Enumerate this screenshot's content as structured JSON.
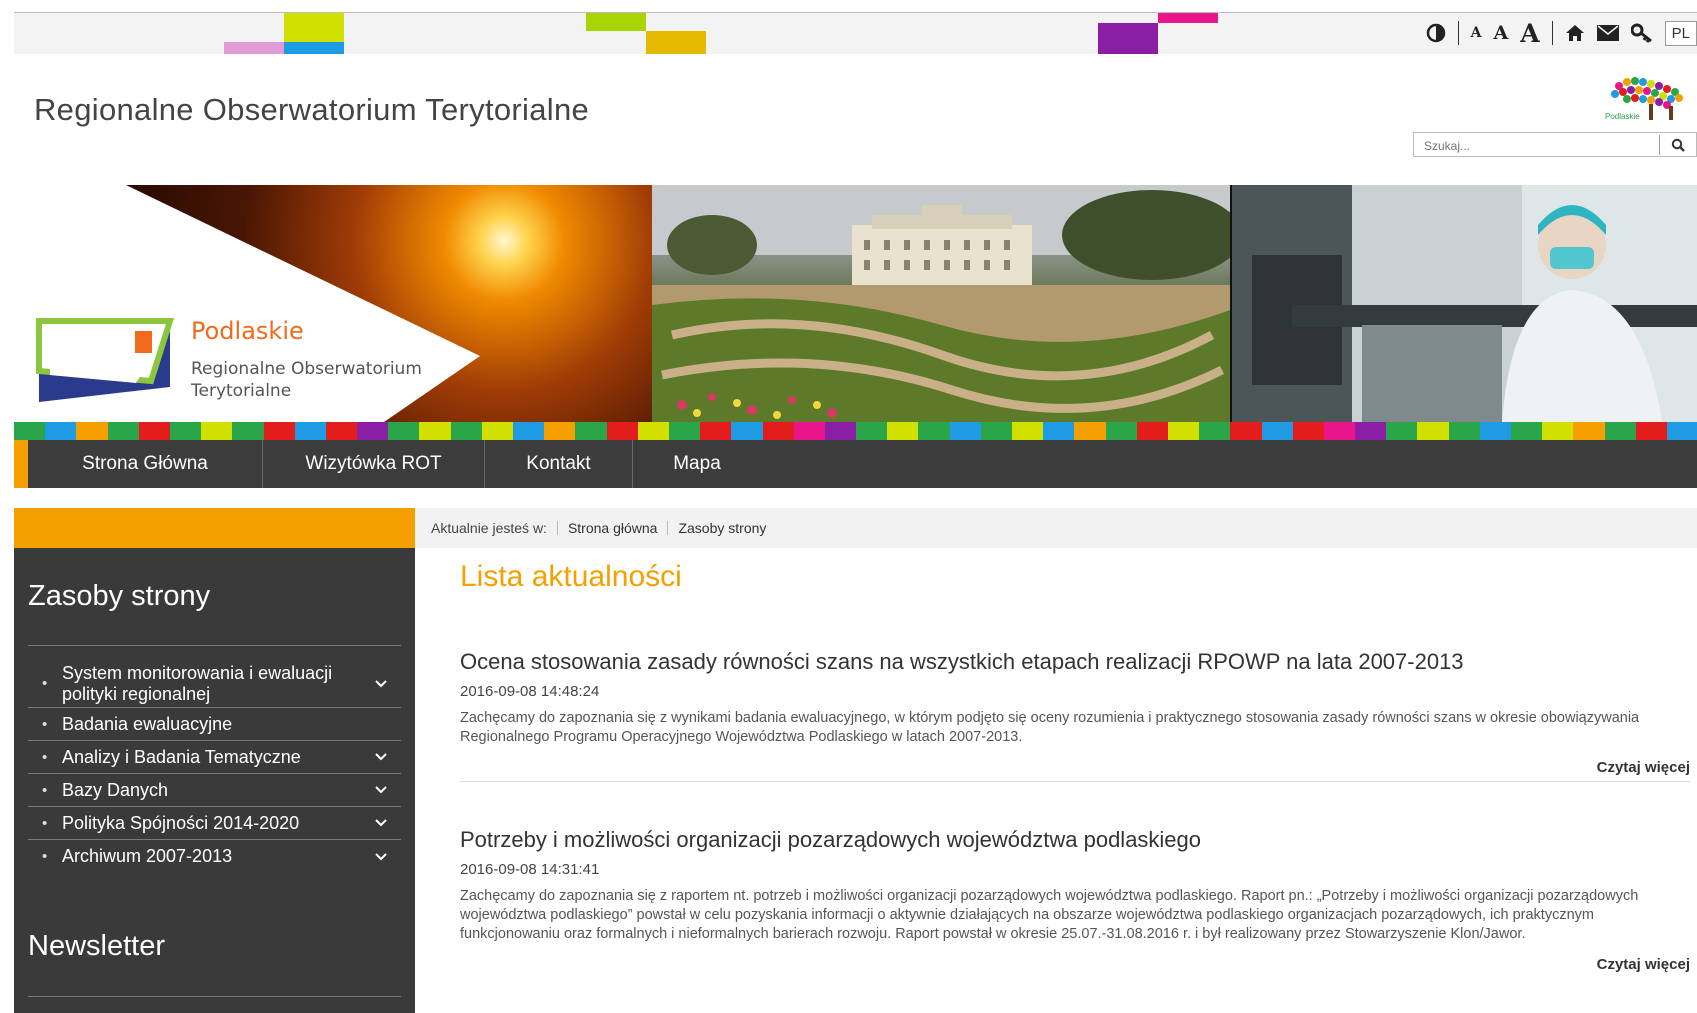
{
  "colors": {
    "accent": "#f5a000",
    "nav_bg": "#3c3c3c",
    "sidebar_bg": "#3a3a3a",
    "title_accent": "#f5a000"
  },
  "toolbar": {
    "icons": [
      "contrast-icon",
      "font-small-icon",
      "font-medium-icon",
      "font-large-icon",
      "home-icon",
      "mail-icon",
      "key-icon"
    ],
    "font_small": "A",
    "font_medium": "A",
    "font_large": "A",
    "language": "PL"
  },
  "header": {
    "site_title": "Regionalne Obserwatorium Terytorialne",
    "brand_logo_text": "Podlaskie"
  },
  "search": {
    "placeholder": "Szukaj...",
    "icon": "search-icon"
  },
  "banner": {
    "logo_name": "Podlaskie",
    "logo_subtitle_line1": "Regionalne Obserwatorium",
    "logo_subtitle_line2": "Terytorialne"
  },
  "nav": {
    "items": [
      {
        "label": "Strona Główna"
      },
      {
        "label": "Wizytówka ROT"
      },
      {
        "label": "Kontakt"
      },
      {
        "label": "Mapa"
      }
    ]
  },
  "breadcrumb": {
    "prefix": "Aktualnie jesteś w:",
    "items": [
      "Strona główna",
      "Zasoby strony"
    ]
  },
  "sidebar": {
    "title": "Zasoby strony",
    "menu": [
      {
        "label": "System monitorowania i ewaluacji polityki regionalnej",
        "has_submenu": true
      },
      {
        "label": "Badania ewaluacyjne",
        "has_submenu": false
      },
      {
        "label": "Analizy i Badania Tematyczne",
        "has_submenu": true
      },
      {
        "label": "Bazy Danych",
        "has_submenu": true
      },
      {
        "label": "Polityka Spójności 2014-2020",
        "has_submenu": true
      },
      {
        "label": "Archiwum 2007-2013",
        "has_submenu": true
      }
    ],
    "newsletter_title": "Newsletter"
  },
  "main": {
    "list_title": "Lista aktualności",
    "articles": [
      {
        "title": "Ocena stosowania zasady równości szans na wszystkich etapach realizacji RPOWP na lata 2007-2013",
        "date": "2016-09-08 14:48:24",
        "body": "Zachęcamy do zapoznania się z wynikami badania ewaluacyjnego, w którym podjęto się oceny rozumienia i praktycznego stosowania zasady równości szans w okresie obowiązywania Regionalnego Programu Operacyjnego Województwa Podlaskiego w latach 2007-2013.",
        "more": "Czytaj więcej"
      },
      {
        "title": "Potrzeby i możliwości organizacji pozarządowych województwa podlaskiego",
        "date": "2016-09-08 14:31:41",
        "body": "Zachęcamy do zapoznania się z raportem nt. potrzeb i możliwości organizacji pozarządowych województwa podlaskiego. Raport pn.: „Potrzeby i możliwości organizacji pozarządowych województwa podlaskiego” powstał w celu pozyskania informacji o aktywnie działających na obszarze województwa podlaskiego organizacjach pozarządowych, ich praktycznym funkcjonowaniu oraz formalnych i nieformalnych barierach rozwoju. Raport powstał w okresie 25.07.-31.08.2016 r. i był realizowany przez Stowarzyszenie Klon/Jawor.",
        "more": "Czytaj więcej"
      }
    ]
  }
}
